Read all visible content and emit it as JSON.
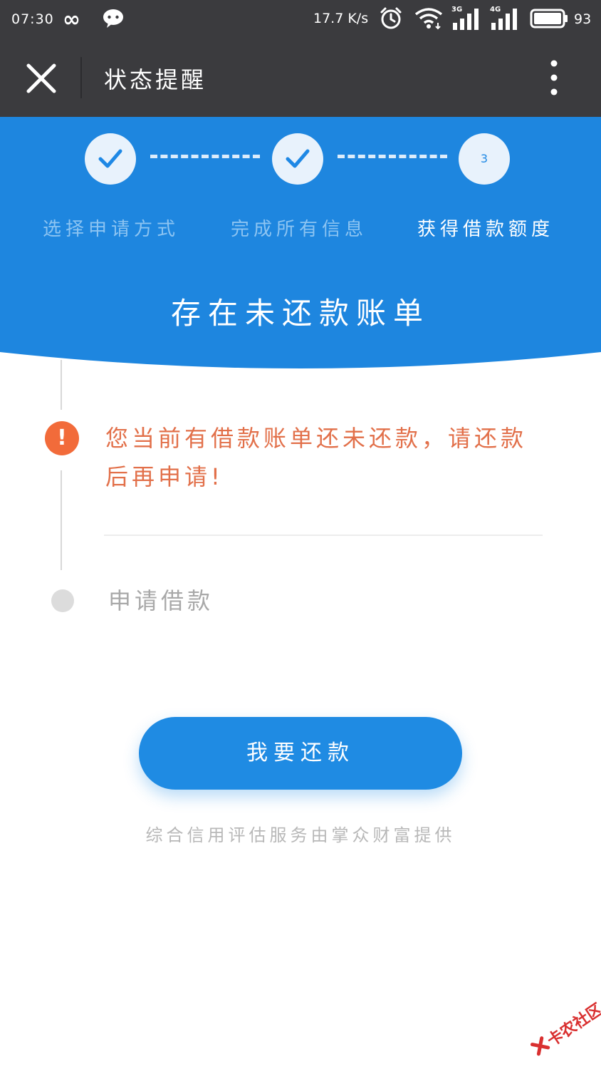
{
  "status_bar": {
    "time": "07:30",
    "infinity_icon": "∞",
    "net_speed": "17.7 K/s",
    "signal_1_tag": "3G",
    "signal_2_tag": "4G",
    "battery_level": "93",
    "icons": [
      "infinity-icon",
      "wechat-icon",
      "alarm-icon",
      "wifi-icon",
      "signal-3g-icon",
      "signal-4g-icon",
      "battery-icon"
    ]
  },
  "titlebar": {
    "title": "状态提醒",
    "close_icon": "close-icon",
    "more_icon": "more-vertical-icon"
  },
  "steps": {
    "items": [
      {
        "label": "选择申请方式",
        "state": "done",
        "icon": "check-icon"
      },
      {
        "label": "完成所有信息",
        "state": "done",
        "icon": "check-icon"
      },
      {
        "label": "获得借款额度",
        "state": "current",
        "number": "3"
      }
    ]
  },
  "header": {
    "title": "存在未还款账单"
  },
  "timeline": {
    "alert_symbol": "!",
    "alert_message": "您当前有借款账单还未还款，请还款后再申请!",
    "next_step": "申请借款"
  },
  "actions": {
    "repay_label": "我要还款"
  },
  "footer": {
    "note": "综合信用评估服务由掌众财富提供"
  },
  "watermark": {
    "text": "卡农社区"
  },
  "colors": {
    "status_bar_bg": "#3b3b3e",
    "header_blue": "#1e86df",
    "button_blue": "#1f8be3",
    "alert_orange": "#f26b3a",
    "alert_text": "#e2704a",
    "muted_gray": "#a8a8a8"
  }
}
